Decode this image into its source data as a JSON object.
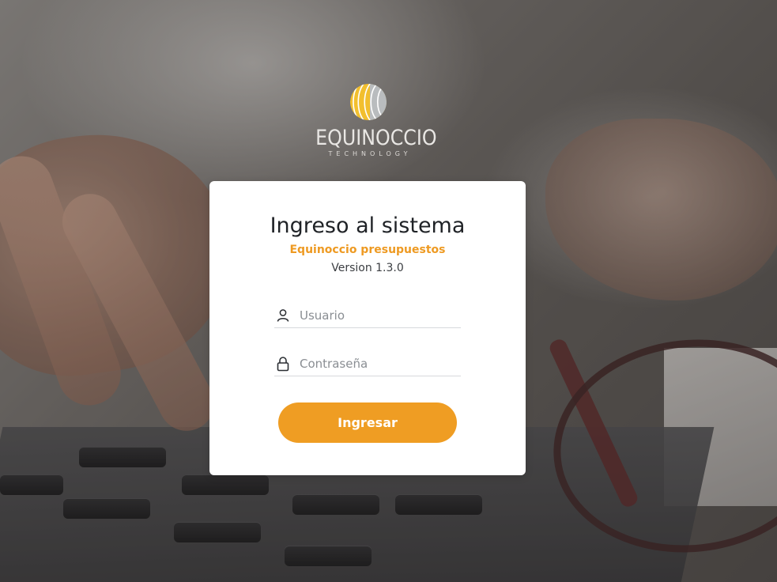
{
  "brand": {
    "name": "EQUINOCCIO",
    "tagline": "TECHNOLOGY"
  },
  "login": {
    "title": "Ingreso al sistema",
    "subtitle": "Equinoccio presupuestos",
    "version": "Version 1.3.0",
    "username_placeholder": "Usuario",
    "username_value": "",
    "password_placeholder": "Contraseña",
    "password_value": "",
    "submit_label": "Ingresar"
  },
  "icons": {
    "user": "user-icon",
    "lock": "lock-icon"
  },
  "colors": {
    "accent": "#ef9d23",
    "logo_yellow": "#f2bf2e",
    "logo_gray": "#b9bcbe",
    "card_background": "#ffffff",
    "title_text": "#1f2226"
  }
}
